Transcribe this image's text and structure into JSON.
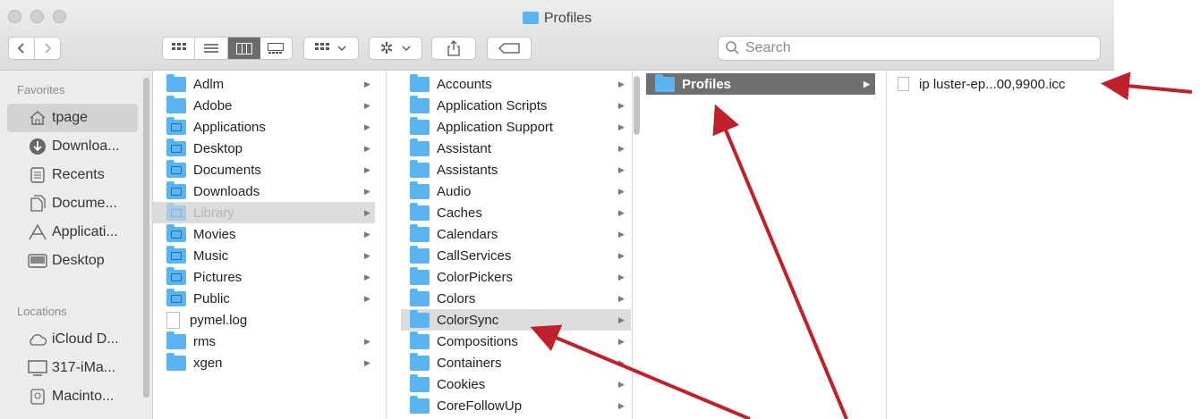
{
  "window": {
    "title": "Profiles",
    "search_placeholder": "Search"
  },
  "sidebar": {
    "favorites_label": "Favorites",
    "locations_label": "Locations",
    "favorites": [
      {
        "label": "tpage",
        "icon": "home-icon"
      },
      {
        "label": "Downloa...",
        "icon": "download-icon"
      },
      {
        "label": "Recents",
        "icon": "recents-icon"
      },
      {
        "label": "Docume...",
        "icon": "documents-icon"
      },
      {
        "label": "Applicati...",
        "icon": "applications-icon"
      },
      {
        "label": "Desktop",
        "icon": "desktop-icon"
      }
    ],
    "locations": [
      {
        "label": "iCloud D...",
        "icon": "cloud-icon"
      },
      {
        "label": "317-iMa...",
        "icon": "computer-icon"
      },
      {
        "label": "Macinto...",
        "icon": "disk-icon"
      }
    ]
  },
  "column1": [
    {
      "label": "Adlm"
    },
    {
      "label": "Adobe"
    },
    {
      "label": "Applications"
    },
    {
      "label": "Desktop"
    },
    {
      "label": "Documents"
    },
    {
      "label": "Downloads"
    },
    {
      "label": "Library"
    },
    {
      "label": "Movies"
    },
    {
      "label": "Music"
    },
    {
      "label": "Pictures"
    },
    {
      "label": "Public"
    },
    {
      "label": "pymel.log"
    },
    {
      "label": "rms"
    },
    {
      "label": "xgen"
    }
  ],
  "column2": [
    {
      "label": "Accounts"
    },
    {
      "label": "Application Scripts"
    },
    {
      "label": "Application Support"
    },
    {
      "label": "Assistant"
    },
    {
      "label": "Assistants"
    },
    {
      "label": "Audio"
    },
    {
      "label": "Caches"
    },
    {
      "label": "Calendars"
    },
    {
      "label": "CallServices"
    },
    {
      "label": "ColorPickers"
    },
    {
      "label": "Colors"
    },
    {
      "label": "ColorSync"
    },
    {
      "label": "Compositions"
    },
    {
      "label": "Containers"
    },
    {
      "label": "Cookies"
    },
    {
      "label": "CoreFollowUp"
    }
  ],
  "column3": [
    {
      "label": "Profiles"
    }
  ],
  "column4": [
    {
      "label": "ip luster-ep...00,9900.icc"
    }
  ],
  "colors": {
    "folder": "#5ab4ef",
    "selection": "#6f6f6f",
    "annotation_arrow": "#c0202a"
  }
}
